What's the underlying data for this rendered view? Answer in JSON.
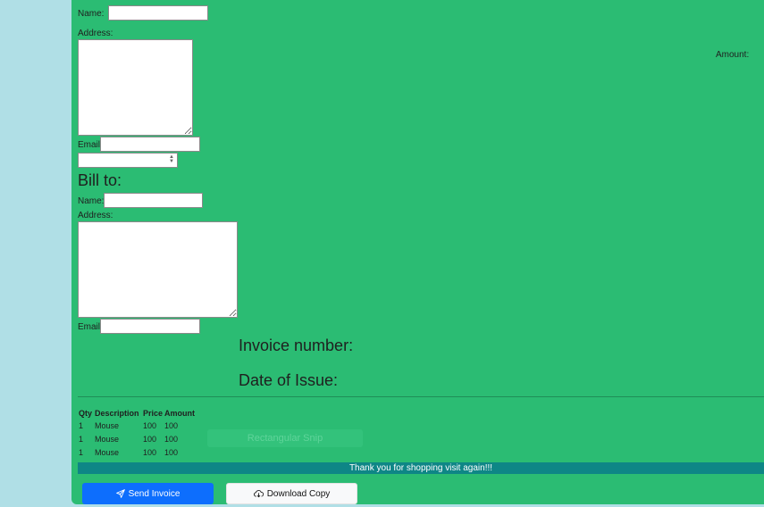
{
  "from": {
    "name_label": "Name:",
    "address_label": "Address:",
    "email_label": "Email:"
  },
  "amount_label": "Amount:",
  "bill_to": {
    "heading": "Bill to:",
    "name_label": "Name:",
    "address_label": "Address:",
    "email_label": "Email:"
  },
  "invoice_number_label": "Invoice number:",
  "date_of_issue_label": "Date of Issue:",
  "table": {
    "headers": [
      "Qty",
      "Description",
      "Price",
      "Amount"
    ],
    "rows": [
      [
        "1",
        "Mouse",
        "100",
        "100"
      ],
      [
        "1",
        "Mouse",
        "100",
        "100"
      ],
      [
        "1",
        "Mouse",
        "100",
        "100"
      ]
    ]
  },
  "shipping_label": "Rectangular Snip",
  "thanks_message": "Thank you for shopping visit again!!!",
  "buttons": {
    "send": "Send Invoice",
    "download": "Download Copy"
  },
  "colors": {
    "page_bg": "#b0dfe6",
    "panel_bg": "#2bbc73",
    "banner_bg": "#0e8686",
    "send_btn": "#0d6efd"
  }
}
